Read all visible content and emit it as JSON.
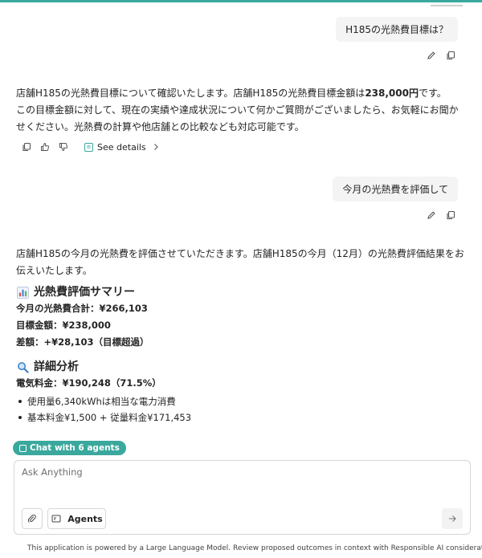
{
  "conversation": {
    "user_messages": [
      {
        "text": "H185の光熱費目標は？"
      },
      {
        "text": "今月の光熱費を評価して"
      }
    ],
    "assistant_1": {
      "line1_prefix": "店舗H185の光熱費目標について確認いたします。店舗H185の光熱費目標金額は",
      "line1_bold": "238,000円",
      "line1_suffix": "です。",
      "line2": "この目標金額に対して、現在の実績や達成状況について何かご質問がございましたら、お気軽にお聞か",
      "line3": "せください。光熱費の計算や他店舗との比較なども対応可能です。",
      "see_details_label": "See details"
    },
    "assistant_2": {
      "intro_line1": "店舗H185の今月の光熱費を評価させていただきます。店舗H185の今月（12月）の光熱費評価結果をお",
      "intro_line2": "伝えいたします。",
      "summary_emoji": "📊",
      "summary_heading": "光熱費評価サマリー",
      "summary_lines": [
        "今月の光熱費合計：¥266,103",
        "目標金額：¥238,000",
        "差額：+¥28,103（目標超過）"
      ],
      "detail_emoji": "🔍",
      "detail_heading": "詳細分析",
      "electricity_line": "電気料金：¥190,248（71.5%）",
      "bullets": [
        "使用量6,340kWhは相当な電力消費",
        "基本料金¥1,500 + 従量料金¥171,453"
      ]
    }
  },
  "composer": {
    "chat_with_agents_label": "Chat with 6 agents",
    "placeholder": "Ask Anything",
    "agents_button_label": "Agents"
  },
  "footer": {
    "disclaimer": "This application is powered by a Large Language Model. Review proposed outcomes in context with Responsible AI considerations"
  },
  "icons": {
    "edit": "pencil-icon",
    "copy": "copy-icon",
    "thumbs_up": "thumbs-up-icon",
    "thumbs_down": "thumbs-down-icon",
    "see_details": "info-box-icon",
    "chevron": "chevron-right-icon",
    "attach": "paperclip-icon",
    "agents": "agents-icon",
    "send": "send-arrow-icon"
  },
  "colors": {
    "accent": "#3aa89d",
    "user_bubble": "#f4f4f4"
  }
}
